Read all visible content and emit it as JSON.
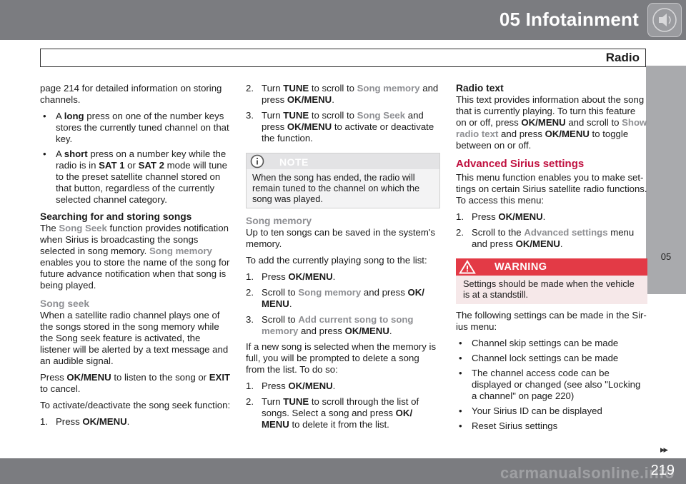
{
  "header": {
    "chapter_title": "05 Infotainment",
    "section_title": "Radio",
    "speaker_icon": "speaker-icon",
    "side_tab_label": "05",
    "next_marker": "▸▸",
    "page_number": "219",
    "watermark": "carmanualsonline.info"
  },
  "col1": {
    "intro": "page 214 for detailed information on storing channels.",
    "bullets": [
      {
        "pre": "A ",
        "bold": "long",
        "post": " press on one of the number keys stores the currently tuned channel on that key."
      },
      {
        "pre": "A ",
        "bold": "short",
        "post": " press on a number key while the radio is in ",
        "b2": "SAT 1",
        "mid": " or ",
        "b3": "SAT 2",
        "end": " mode will tune to the preset satellite channel stored on that button, regardless of the currently selected channel category."
      }
    ],
    "heading1": "Searching for and storing songs",
    "p1": {
      "a": "The ",
      "hl1": "Song Seek",
      "b": " function provides notification when Sirius is broadcasting the songs selected in song memory. ",
      "hl2": "Song memory",
      "c": " enables you to store the name of the song for future advance notification when that song is being played."
    },
    "heading2": "Song seek",
    "p2": "When a satellite radio channel plays one of the songs stored in the song memory while the Song seek feature is activated, the listener will be alerted by a text message and an audible signal.",
    "p3": {
      "a": "Press ",
      "b1": "OK/MENU",
      "b": " to listen to the song or ",
      "b2": "EXIT",
      "c": " to cancel."
    },
    "p4": "To activate/deactivate the song seek function:",
    "step1": {
      "n": "1.",
      "a": "Press ",
      "b": "OK/MENU",
      "c": "."
    }
  },
  "col2": {
    "step2": {
      "n": "2.",
      "a": "Turn ",
      "b": "TUNE",
      "c": " to scroll to ",
      "hl": "Song memory",
      "d": " and press ",
      "b2": "OK/MENU",
      "e": "."
    },
    "step3": {
      "n": "3.",
      "a": "Turn ",
      "b": "TUNE",
      "c": " to scroll to ",
      "hl": "Song Seek",
      "d": " and press ",
      "b2": "OK/MENU",
      "e": " to activate or deactivate the function."
    },
    "note_label": "NOTE",
    "note_text": "When the song has ended, the radio will remain tuned to the channel on which the song was played.",
    "heading": "Song memory",
    "p1": "Up to ten songs can be saved in the system's memory.",
    "p2": "To add the currently playing song to the list:",
    "s1": {
      "n": "1.",
      "a": "Press ",
      "b": "OK/MENU",
      "c": "."
    },
    "s2": {
      "n": "2.",
      "a": "Scroll to ",
      "hl": "Song memory",
      "b": " and press ",
      "b2": "OK/ MENU",
      "c": "."
    },
    "s3": {
      "n": "3.",
      "a": "Scroll to ",
      "hl": "Add current song to song memory",
      "b": " and press ",
      "b2": "OK/MENU",
      "c": "."
    },
    "p3": "If a new song is selected when the memory is full, you will be prompted to delete a song from the list. To do so:",
    "t1": {
      "n": "1.",
      "a": "Press ",
      "b": "OK/MENU",
      "c": "."
    },
    "t2": {
      "n": "2.",
      "a": "Turn ",
      "b": "TUNE",
      "c": " to scroll through the list of songs. Select a song and press ",
      "b2": "OK/ MENU",
      "d": " to delete it from the list."
    }
  },
  "col3": {
    "heading1": "Radio text",
    "p1": {
      "a": "This text provides information about the song that is currently playing. To turn this feature on or off, press ",
      "b1": "OK/MENU",
      "b": " and scroll to ",
      "hl": "Show radio text",
      "c": " and press ",
      "b2": "OK/MENU",
      "d": " to toggle between on or off."
    },
    "heading2": "Advanced Sirius settings",
    "p2": "This menu function enables you to make set-tings on certain Sirius satellite radio functions. To access this menu:",
    "s1": {
      "n": "1.",
      "a": "Press ",
      "b": "OK/MENU",
      "c": "."
    },
    "s2": {
      "n": "2.",
      "a": "Scroll to the ",
      "hl": "Advanced settings",
      "b": " menu and press ",
      "b2": "OK/MENU",
      "c": "."
    },
    "warning_label": "WARNING",
    "warning_text": "Settings should be made when the vehicle is at a standstill.",
    "p3": "The following settings can be made in the Sir-ius menu:",
    "bullets": [
      "Channel skip settings can be made",
      "Channel lock settings can be made",
      "The channel access code can be displayed or changed (see also \"Locking a channel\" on page 220)",
      "Your Sirius ID can be displayed",
      "Reset Sirius settings"
    ],
    "colors": {
      "heading_red": "#c0103f",
      "highlight_grey": "#8e8f93",
      "warning_red": "#e33a46"
    }
  }
}
